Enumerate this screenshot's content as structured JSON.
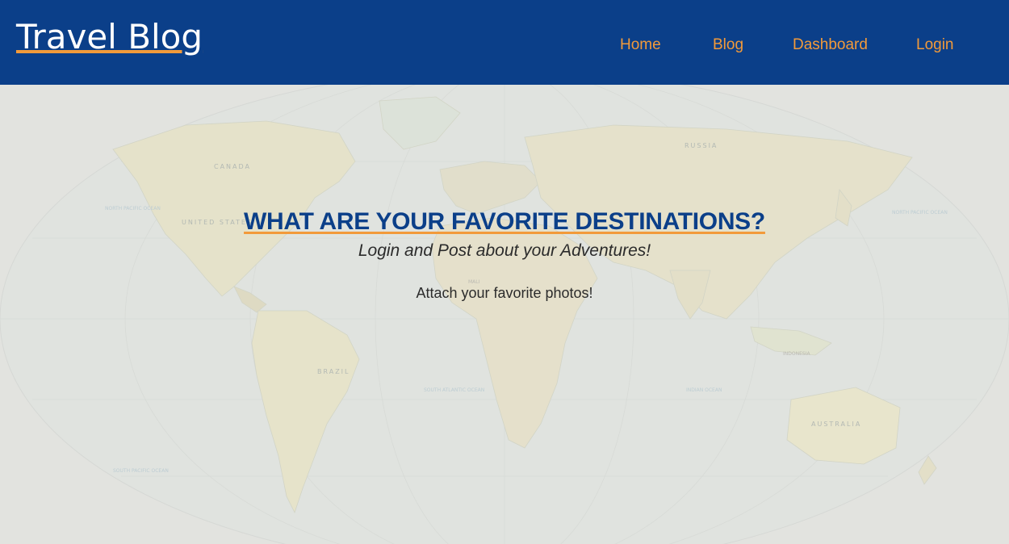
{
  "navbar": {
    "brand": "Travel Blog",
    "links": [
      {
        "label": "Home"
      },
      {
        "label": "Blog"
      },
      {
        "label": "Dashboard"
      },
      {
        "label": "Login"
      }
    ]
  },
  "map": {
    "labels": [
      "RUSSIA",
      "CANADA",
      "UNITED STATES",
      "BRAZIL",
      "AUSTRALIA",
      "NORTH PACIFIC OCEAN",
      "NORTH PACIFIC OCEAN",
      "SOUTH ATLANTIC OCEAN",
      "INDIAN OCEAN",
      "SOUTH PACIFIC OCEAN",
      "MALI",
      "INDONESIA"
    ]
  },
  "hero": {
    "title": "WHAT ARE YOUR FAVORITE DESTINATIONS?",
    "subtitle": "Login and Post about your Adventures!",
    "note": "Attach your favorite photos!"
  },
  "colors": {
    "nav_bg": "#0b3f89",
    "accent": "#f29a3a",
    "page_bg": "#e2e3df"
  }
}
